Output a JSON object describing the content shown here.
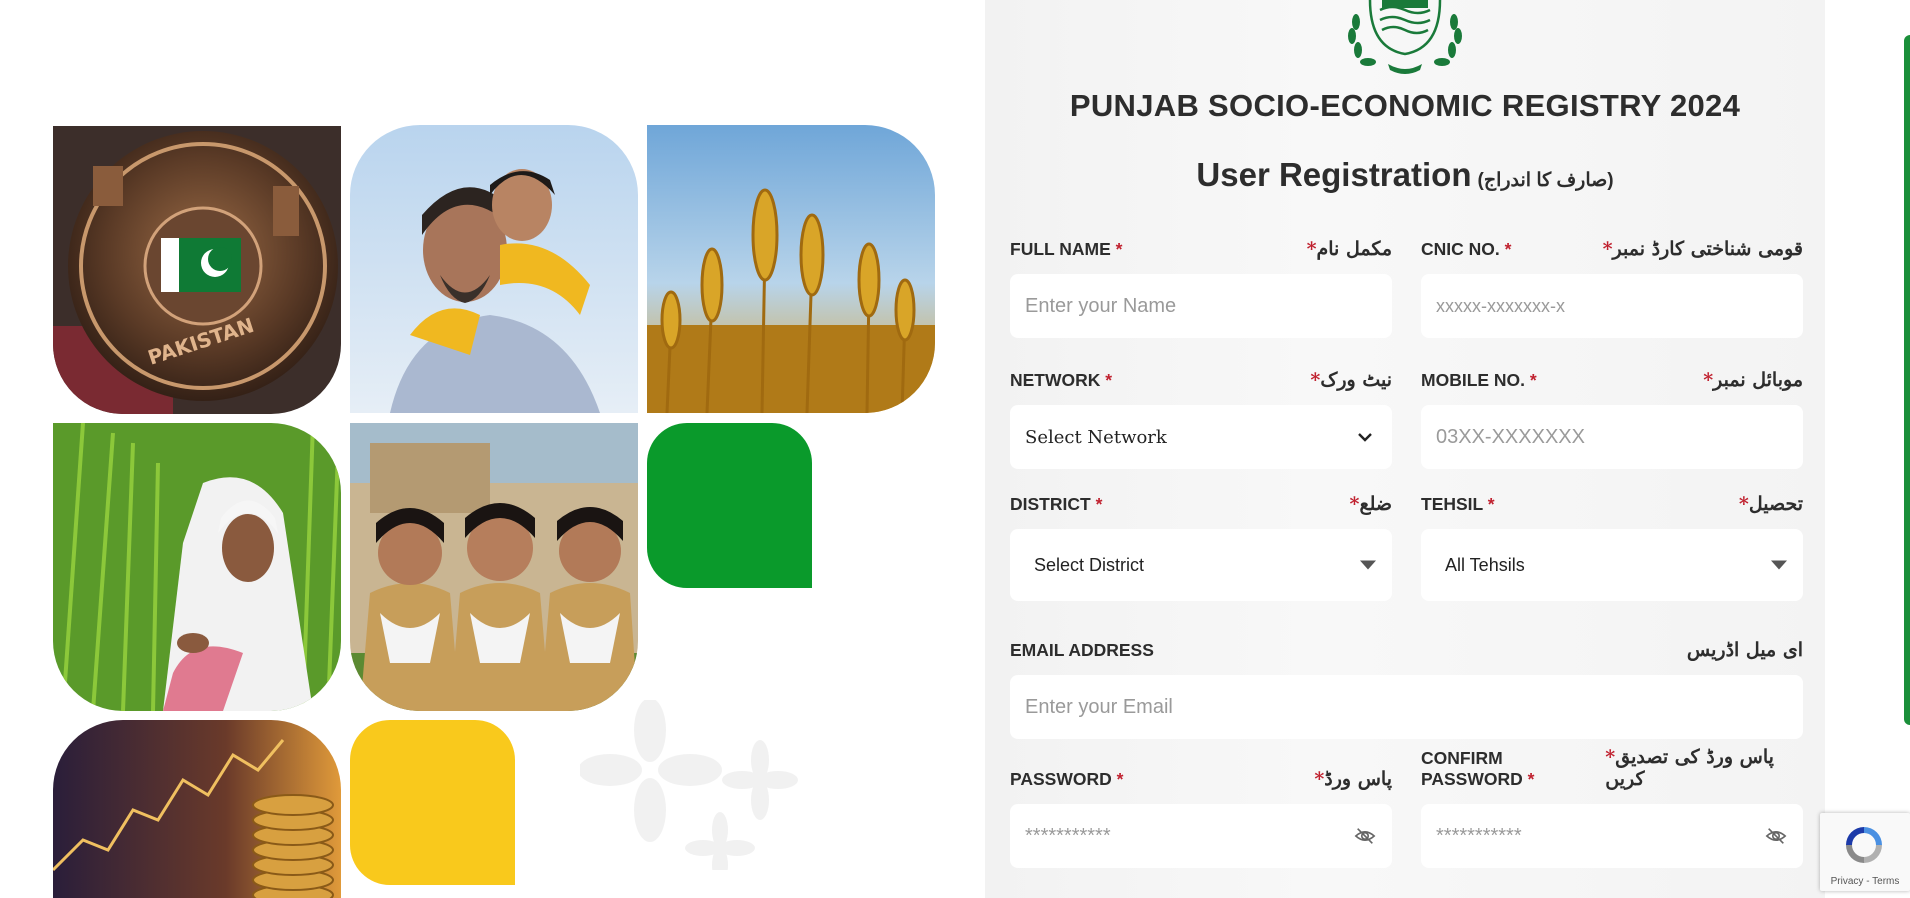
{
  "header": {
    "title": "PUNJAB SOCIO-ECONOMIC REGISTRY 2024",
    "subtitle_en": "User Registration",
    "subtitle_ur": "(صارف کا اندراج)"
  },
  "form": {
    "full_name": {
      "label_en": "FULL NAME",
      "label_ur": "مکمل نام",
      "placeholder": "Enter your Name"
    },
    "cnic": {
      "label_en": "CNIC NO.",
      "label_ur": "قومی شناختی کارڈ نمبر",
      "placeholder": "xxxxx-xxxxxxx-x"
    },
    "network": {
      "label_en": "NETWORK",
      "label_ur": "نیٹ ورک",
      "selected": "Select Network"
    },
    "mobile": {
      "label_en": "MOBILE NO.",
      "label_ur": "موبائل نمبر",
      "placeholder": "03XX-XXXXXXX"
    },
    "district": {
      "label_en": "DISTRICT",
      "label_ur": "ضلع",
      "selected": "Select District"
    },
    "tehsil": {
      "label_en": "TEHSIL",
      "label_ur": "تحصیل",
      "selected": "All Tehsils"
    },
    "email": {
      "label_en": "EMAIL ADDRESS",
      "label_ur": "ای میل اڈریس",
      "placeholder": "Enter your Email"
    },
    "password": {
      "label_en": "PASSWORD",
      "label_ur": "پاس ورڈ",
      "placeholder": "***********"
    },
    "confirm_password": {
      "label_en": "CONFIRM PASSWORD",
      "label_ur": "پاس ورڈ کی تصدیق کریں",
      "placeholder": "***********"
    },
    "required_mark": "*"
  },
  "recaptcha": {
    "links": "Privacy - Terms"
  },
  "colors": {
    "green": "#0a9a2b",
    "yellow": "#f9c91c",
    "required": "#c0212f",
    "text": "#2d2d2d"
  },
  "icons": [
    "chevron-down-icon",
    "dropdown-caret-icon",
    "eye-slash-icon",
    "recaptcha-logo-icon",
    "punjab-government-logo"
  ]
}
